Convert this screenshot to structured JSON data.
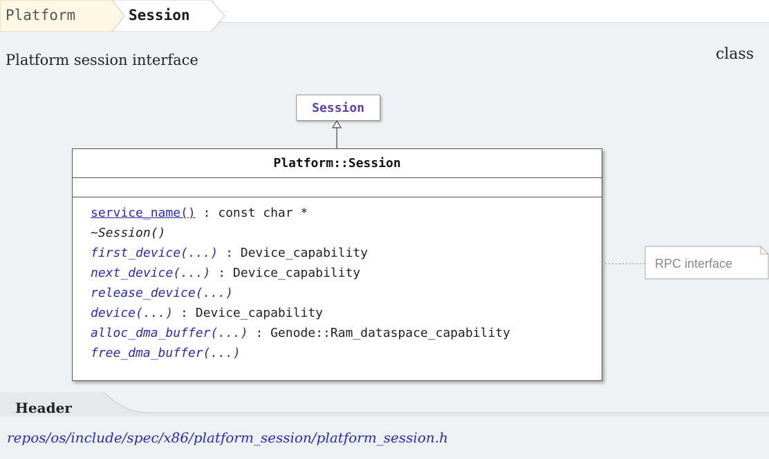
{
  "breadcrumb": {
    "parent": "Platform",
    "current": "Session"
  },
  "summary": {
    "description": "Platform session interface",
    "kind": "class"
  },
  "diagram": {
    "base_class": "Session",
    "class_name": "Platform::Session",
    "operations": [
      {
        "name": "service_name()",
        "ret": " : const char *"
      },
      {
        "name": "~Session()",
        "ret": ""
      },
      {
        "name": "first_device(...)",
        "ret": " : Device_capability"
      },
      {
        "name": "next_device(...)",
        "ret": " : Device_capability"
      },
      {
        "name": "release_device(...)",
        "ret": ""
      },
      {
        "name": "device(...)",
        "ret": " : Device_capability"
      },
      {
        "name": "alloc_dma_buffer(...)",
        "ret": " : Genode::Ram_dataspace_capability"
      },
      {
        "name": "free_dma_buffer(...)",
        "ret": ""
      }
    ],
    "note": "RPC interface"
  },
  "header": {
    "label": "Header",
    "path": "repos/os/include/spec/x86/platform_session/platform_session.h"
  },
  "colors": {
    "panel": "#eef1f3",
    "crumb_fill": "#fdf8e4",
    "link": "#2a2ab8",
    "base_class_text": "#5b3fb0"
  }
}
